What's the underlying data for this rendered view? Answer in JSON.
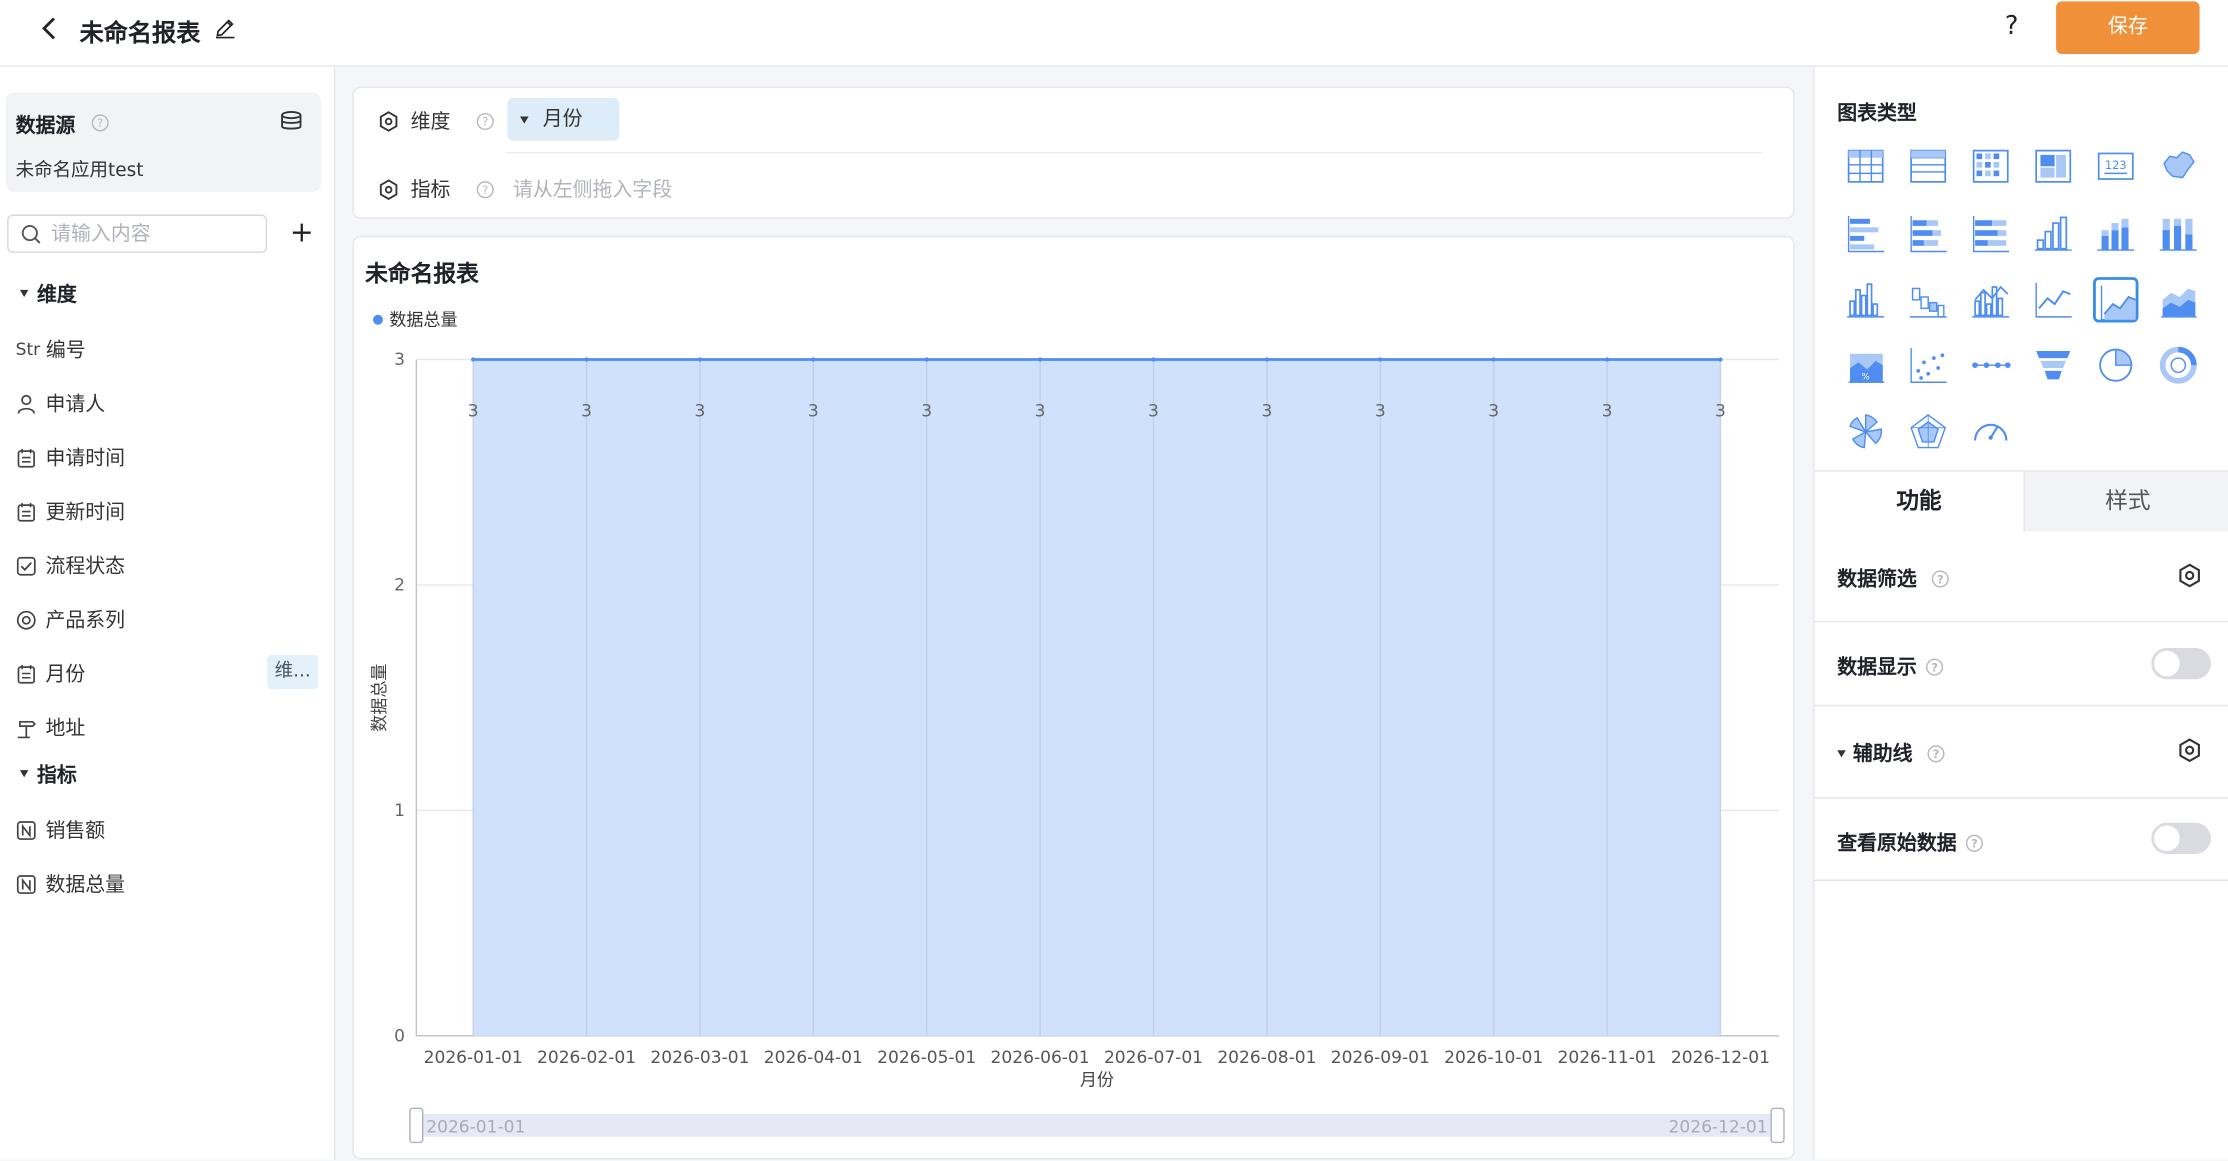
{
  "header": {
    "title": "未命名报表",
    "help": "?",
    "save_label": "保存"
  },
  "left": {
    "datasource_label": "数据源",
    "app_name": "未命名应用test",
    "search_placeholder": "请输入内容",
    "dimensions_header": "维度",
    "dimensions": [
      {
        "type_prefix": "Str",
        "label": "编号",
        "icon": "text-type-icon"
      },
      {
        "label": "申请人",
        "icon": "person-icon"
      },
      {
        "label": "申请时间",
        "icon": "calendar-icon"
      },
      {
        "label": "更新时间",
        "icon": "calendar-icon"
      },
      {
        "label": "流程状态",
        "icon": "checkbox-icon"
      },
      {
        "label": "产品系列",
        "icon": "radio-icon"
      },
      {
        "label": "月份",
        "icon": "calendar-icon",
        "tag": "维..."
      },
      {
        "label": "地址",
        "icon": "location-icon"
      }
    ],
    "metrics_header": "指标",
    "metrics": [
      {
        "label": "销售额",
        "icon": "number-icon"
      },
      {
        "label": "数据总量",
        "icon": "number-icon"
      }
    ]
  },
  "config": {
    "dimension_label": "维度",
    "dimension_chip": "月份",
    "metric_label": "指标",
    "metric_placeholder": "请从左侧拖入字段"
  },
  "chart_title": "未命名报表",
  "chart_data": {
    "type": "area",
    "legend": "数据总量",
    "xlabel": "月份",
    "ylabel": "数据总量",
    "x": [
      "2026-01-01",
      "2026-02-01",
      "2026-03-01",
      "2026-04-01",
      "2026-05-01",
      "2026-06-01",
      "2026-07-01",
      "2026-08-01",
      "2026-09-01",
      "2026-10-01",
      "2026-11-01",
      "2026-12-01"
    ],
    "series": [
      {
        "name": "数据总量",
        "values": [
          3,
          3,
          3,
          3,
          3,
          3,
          3,
          3,
          3,
          3,
          3,
          3
        ]
      }
    ],
    "ylim": [
      0,
      3
    ],
    "yticks": [
      0,
      1,
      2,
      3
    ],
    "grid": true,
    "zoom_start": "2026-01-01",
    "zoom_end": "2026-12-01",
    "color": "#4f8ef0",
    "fill": "#cfe1fb"
  },
  "right": {
    "chart_type_header": "图表类型",
    "chart_types": [
      "table-chart-icon",
      "detail-table-icon",
      "crosstab-icon",
      "card-icon",
      "number-card-icon",
      "map-chart-icon",
      "bar-chart-icon",
      "stacked-bar-icon",
      "percent-bar-icon",
      "column-chart-icon",
      "stacked-column-icon",
      "percent-column-icon",
      "grouped-column-icon",
      "waterfall-icon",
      "line-column-icon",
      "line-chart-icon",
      "area-chart-icon",
      "stacked-area-icon",
      "percent-area-icon",
      "scatter-icon",
      "relation-icon",
      "funnel-icon",
      "pie-chart-icon",
      "donut-chart-icon",
      "rose-chart-icon",
      "radar-chart-icon",
      "gauge-chart-icon"
    ],
    "selected_chart_type": "area-chart-icon",
    "tab_function": "功能",
    "tab_style": "样式",
    "options": [
      {
        "label": "数据筛选",
        "control": "gear"
      },
      {
        "label": "数据显示",
        "control": "toggle",
        "on": false
      },
      {
        "label": "辅助线",
        "control": "gear",
        "collapsible": true
      },
      {
        "label": "查看原始数据",
        "control": "toggle",
        "on": false
      }
    ]
  },
  "colors": {
    "accent": "#f0913a",
    "primary": "#4f8ef0",
    "chip_bg": "#dcecf9"
  }
}
